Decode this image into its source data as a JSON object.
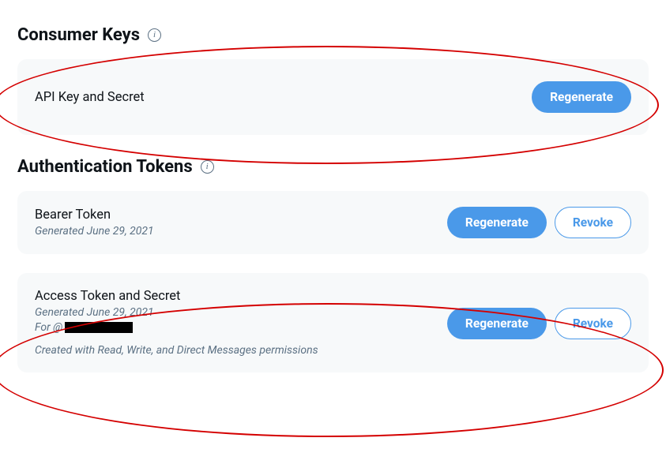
{
  "sections": {
    "consumer": {
      "heading": "Consumer Keys"
    },
    "auth": {
      "heading": "Authentication Tokens"
    }
  },
  "cards": {
    "apiKey": {
      "title": "API Key and Secret",
      "regenerate": "Regenerate"
    },
    "bearer": {
      "title": "Bearer Token",
      "generated": "Generated June 29, 2021",
      "regenerate": "Regenerate",
      "revoke": "Revoke"
    },
    "access": {
      "title": "Access Token and Secret",
      "generated": "Generated June 29, 2021",
      "forPrefix": "For @",
      "permPrefix": "Created with ",
      "permLink": "Read, Write, and Direct Messages",
      "permSuffix": " permissions",
      "regenerate": "Regenerate",
      "revoke": "Revoke"
    }
  }
}
